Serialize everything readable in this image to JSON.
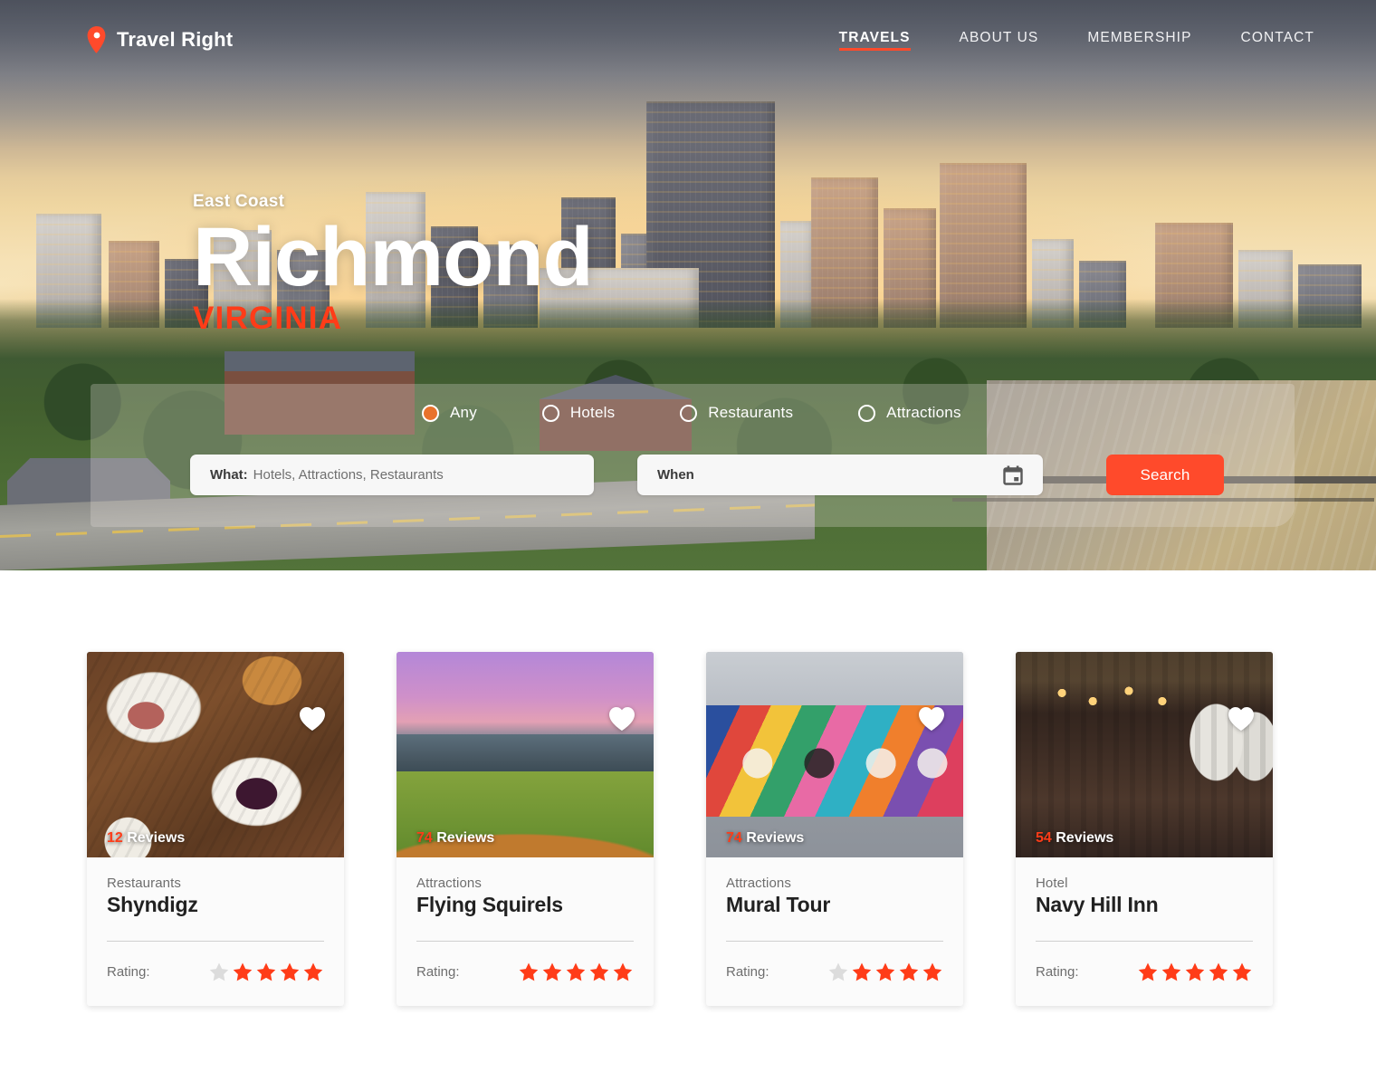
{
  "nav": {
    "brand": "Travel Right",
    "brand_icon": "map-pin-icon",
    "links": [
      {
        "label": "TRAVELS",
        "active": true
      },
      {
        "label": "ABOUT US",
        "active": false
      },
      {
        "label": "MEMBERSHIP",
        "active": false
      },
      {
        "label": "CONTACT",
        "active": false
      }
    ]
  },
  "hero": {
    "eyebrow": "East Coast",
    "city": "Richmond",
    "state": "VIRGINIA"
  },
  "search": {
    "filters": [
      {
        "label": "Any",
        "selected": true
      },
      {
        "label": "Hotels",
        "selected": false
      },
      {
        "label": "Restaurants",
        "selected": false
      },
      {
        "label": "Attractions",
        "selected": false
      }
    ],
    "what_label": "What:",
    "what_placeholder": "Hotels, Attractions, Restaurants",
    "what_value": "",
    "when_placeholder": "When",
    "when_value": "",
    "calendar_icon": "calendar-icon",
    "search_button": "Search"
  },
  "colors": {
    "accent": "#ff4a2b",
    "star_filled": "#ff3c18",
    "star_empty": "#dcdcdc",
    "state_text": "#ff3c18",
    "radio_selected": "#e8722c"
  },
  "cards": [
    {
      "reviews_count": "12",
      "reviews_label": "Reviews",
      "category": "Restaurants",
      "title": "Shyndigz",
      "rating_label": "Rating:",
      "rating": 4,
      "stars_total": 5,
      "favorite_icon": "heart-icon",
      "image_alt": "desserts-on-wood-table"
    },
    {
      "reviews_count": "74",
      "reviews_label": "Reviews",
      "category": "Attractions",
      "title": "Flying Squirels",
      "rating_label": "Rating:",
      "rating": 5,
      "stars_total": 5,
      "favorite_icon": "heart-icon",
      "image_alt": "baseball-stadium"
    },
    {
      "reviews_count": "74",
      "reviews_label": "Reviews",
      "category": "Attractions",
      "title": "Mural Tour",
      "rating_label": "Rating:",
      "rating": 4,
      "stars_total": 5,
      "favorite_icon": "heart-icon",
      "image_alt": "love-mural"
    },
    {
      "reviews_count": "54",
      "reviews_label": "Reviews",
      "category": "Hotel",
      "title": "Navy Hill Inn",
      "rating_label": "Rating:",
      "rating": 5,
      "stars_total": 5,
      "favorite_icon": "heart-icon",
      "image_alt": "richmond-industrial-interior"
    }
  ]
}
